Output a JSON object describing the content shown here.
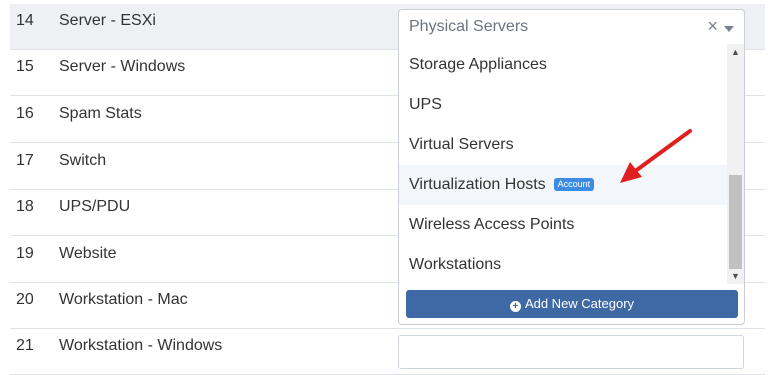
{
  "rows": [
    {
      "num": "14",
      "name": "Server - ESXi"
    },
    {
      "num": "15",
      "name": "Server - Windows"
    },
    {
      "num": "16",
      "name": "Spam Stats"
    },
    {
      "num": "17",
      "name": "Switch"
    },
    {
      "num": "18",
      "name": "UPS/PDU"
    },
    {
      "num": "19",
      "name": "Website"
    },
    {
      "num": "20",
      "name": "Workstation - Mac"
    },
    {
      "num": "21",
      "name": "Workstation - Windows"
    }
  ],
  "select": {
    "value": "Physical Servers",
    "clear_icon": "×"
  },
  "dropdown": {
    "options": [
      {
        "label": "Storage Appliances"
      },
      {
        "label": "UPS"
      },
      {
        "label": "Virtual Servers"
      },
      {
        "label": "Virtualization Hosts",
        "badge": "Account"
      },
      {
        "label": "Wireless Access Points"
      },
      {
        "label": "Workstations"
      }
    ],
    "add_button_label": "Add New Category",
    "add_button_icon": "+"
  },
  "colors": {
    "accent": "#3f69a5",
    "badge": "#3c8ce3",
    "annotation_arrow": "#e02020"
  }
}
